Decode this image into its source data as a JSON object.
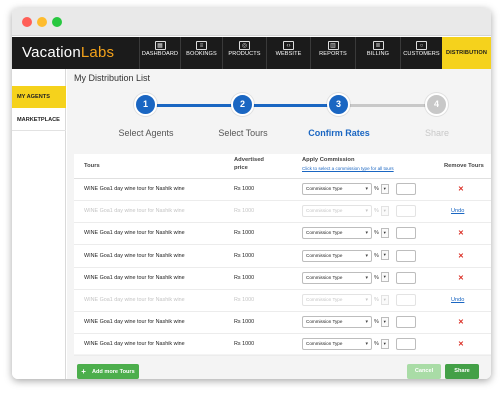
{
  "app": {
    "logo_left": "Vacation",
    "logo_right": "Labs",
    "accent_color": "#f4a21b",
    "nav": [
      {
        "label": "DASHBOARD",
        "icon": "calendar-icon"
      },
      {
        "label": "BOOKINGS",
        "icon": "list-icon"
      },
      {
        "label": "PRODUCTS",
        "icon": "globe-icon"
      },
      {
        "label": "WEBSITE",
        "icon": "code-icon"
      },
      {
        "label": "REPORTS",
        "icon": "chart-icon"
      },
      {
        "label": "BILLING",
        "icon": "document-icon"
      },
      {
        "label": "CUSTOMERS",
        "icon": "user-icon"
      },
      {
        "label": "DISTRIBUTION",
        "icon": "",
        "active": true
      }
    ]
  },
  "sidebar": {
    "items": [
      {
        "label": "MY AGENTS",
        "active": true
      },
      {
        "label": "MARKETPLACE",
        "active": false
      }
    ]
  },
  "page": {
    "title": "My Distribution List"
  },
  "stepper": {
    "active_color": "#1a66c2",
    "inactive_color": "#c8c8c8",
    "steps": [
      {
        "number": "1",
        "label": "Select Agents",
        "state": "done"
      },
      {
        "number": "2",
        "label": "Select Tours",
        "state": "done"
      },
      {
        "number": "3",
        "label": "Confirm Rates",
        "state": "current"
      },
      {
        "number": "4",
        "label": "Share",
        "state": "future"
      }
    ]
  },
  "table": {
    "headers": {
      "tours": "Tours",
      "price_line1": "Advertised",
      "price_line2": "price",
      "commission": "Apply Commission",
      "commission_hint": "Click to select a commission type for all tours",
      "remove": "Remove Tours"
    },
    "select_placeholder": "Commission Type",
    "percent_symbol": "%",
    "remove_symbol": "✕",
    "undo_label": "Undo",
    "rows": [
      {
        "tour": "WINE Goa1 day wine tour for Nashik wine",
        "price": "Rs 1000",
        "removed": false
      },
      {
        "tour": "WINE Goa1 day wine tour for Nashik wine",
        "price": "Rs 1000",
        "removed": true
      },
      {
        "tour": "WINE Goa1 day wine tour for Nashik wine",
        "price": "Rs 1000",
        "removed": false
      },
      {
        "tour": "WINE Goa1 day wine tour for Nashik wine",
        "price": "Rs 1000",
        "removed": false
      },
      {
        "tour": "WINE Goa1 day wine tour for Nashik wine",
        "price": "Rs 1000",
        "removed": false
      },
      {
        "tour": "WINE Goa1 day wine tour for Nashik wine",
        "price": "Rs 1000",
        "removed": true
      },
      {
        "tour": "WINE Goa1 day wine tour for Nashik wine",
        "price": "Rs 1000",
        "removed": false
      },
      {
        "tour": "WINE Goa1 day wine tour for Nashik wine",
        "price": "Rs 1000",
        "removed": false
      }
    ]
  },
  "footer": {
    "add_label": "Add more Tours",
    "cancel_label": "Cancel",
    "share_label": "Share"
  }
}
